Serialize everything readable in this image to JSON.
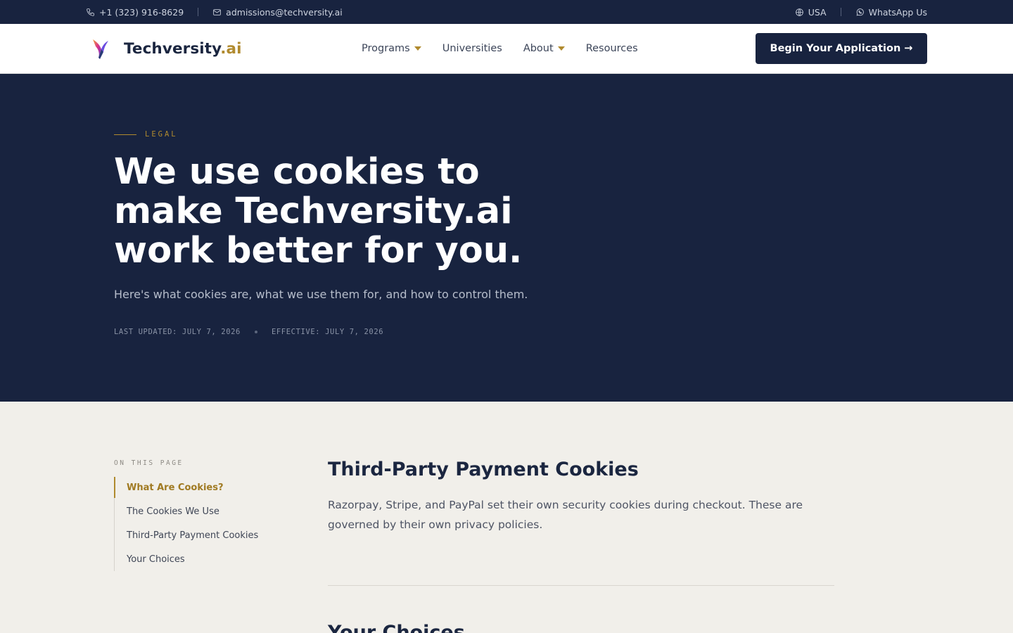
{
  "topbar": {
    "phone": "+1 (323) 916-8629",
    "email": "admissions@techversity.ai",
    "region": "USA",
    "whatsapp": "WhatsApp Us"
  },
  "header": {
    "brand_main": "Techversity",
    "brand_accent": ".ai",
    "nav": [
      {
        "label": "Programs",
        "has_dropdown": true
      },
      {
        "label": "Universities",
        "has_dropdown": false
      },
      {
        "label": "About",
        "has_dropdown": true
      },
      {
        "label": "Resources",
        "has_dropdown": false
      }
    ],
    "cta_label": "Begin Your Application →"
  },
  "hero": {
    "eyebrow": "LEGAL",
    "title": "We use cookies to make Techversity.ai work better for you.",
    "subtitle": "Here's what cookies are, what we use them for, and how to control them.",
    "last_updated": "LAST UPDATED: JULY 7, 2026",
    "effective": "EFFECTIVE: JULY 7, 2026"
  },
  "toc": {
    "label": "ON THIS PAGE",
    "items": [
      {
        "label": "What Are Cookies?",
        "active": true
      },
      {
        "label": "The Cookies We Use",
        "active": false
      },
      {
        "label": "Third-Party Payment Cookies",
        "active": false
      },
      {
        "label": "Your Choices",
        "active": false
      }
    ]
  },
  "article": {
    "heading": "Third-Party Payment Cookies",
    "body": "Razorpay, Stripe, and PayPal set their own security cookies during checkout. These are governed by their own privacy policies.",
    "next_heading": "Your Choices"
  },
  "colors": {
    "navy": "#18233f",
    "gold": "#b08a2e",
    "background": "#f1efea"
  }
}
